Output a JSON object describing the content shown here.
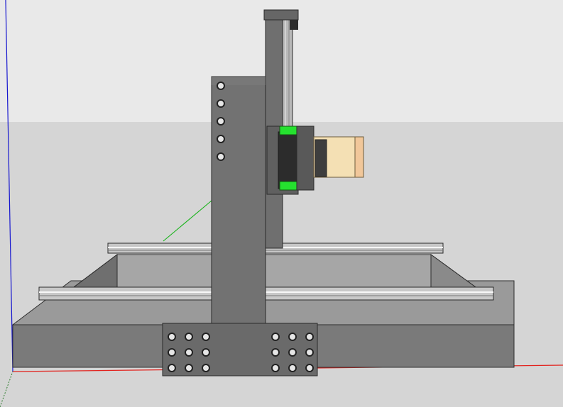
{
  "app": {
    "view_name": "",
    "sky_color": "#e8e8e8",
    "ground_color": "#d6d6d6",
    "axis_colors": {
      "red": "#e0201b",
      "green": "#19b319",
      "blue": "#1515d0"
    }
  },
  "model": {
    "parts": [
      {
        "name": "base-frame",
        "color": "#7b7b7b"
      },
      {
        "name": "gantry-upright",
        "color": "#6e6e6e"
      },
      {
        "name": "z-axis-column",
        "color": "#777777"
      },
      {
        "name": "linear-rails",
        "color": "#b9b9b9"
      },
      {
        "name": "carriage-block",
        "color": "#2d2d2d"
      },
      {
        "name": "rail-stops",
        "color": "#22e032"
      },
      {
        "name": "spindle-body",
        "color": "#f4dfb1"
      },
      {
        "name": "bolt-plate",
        "color": "#6a6a6a"
      }
    ],
    "bolt_rows_upright": 5,
    "bolt_grid_left": "3x3",
    "bolt_grid_right": "3x3"
  }
}
